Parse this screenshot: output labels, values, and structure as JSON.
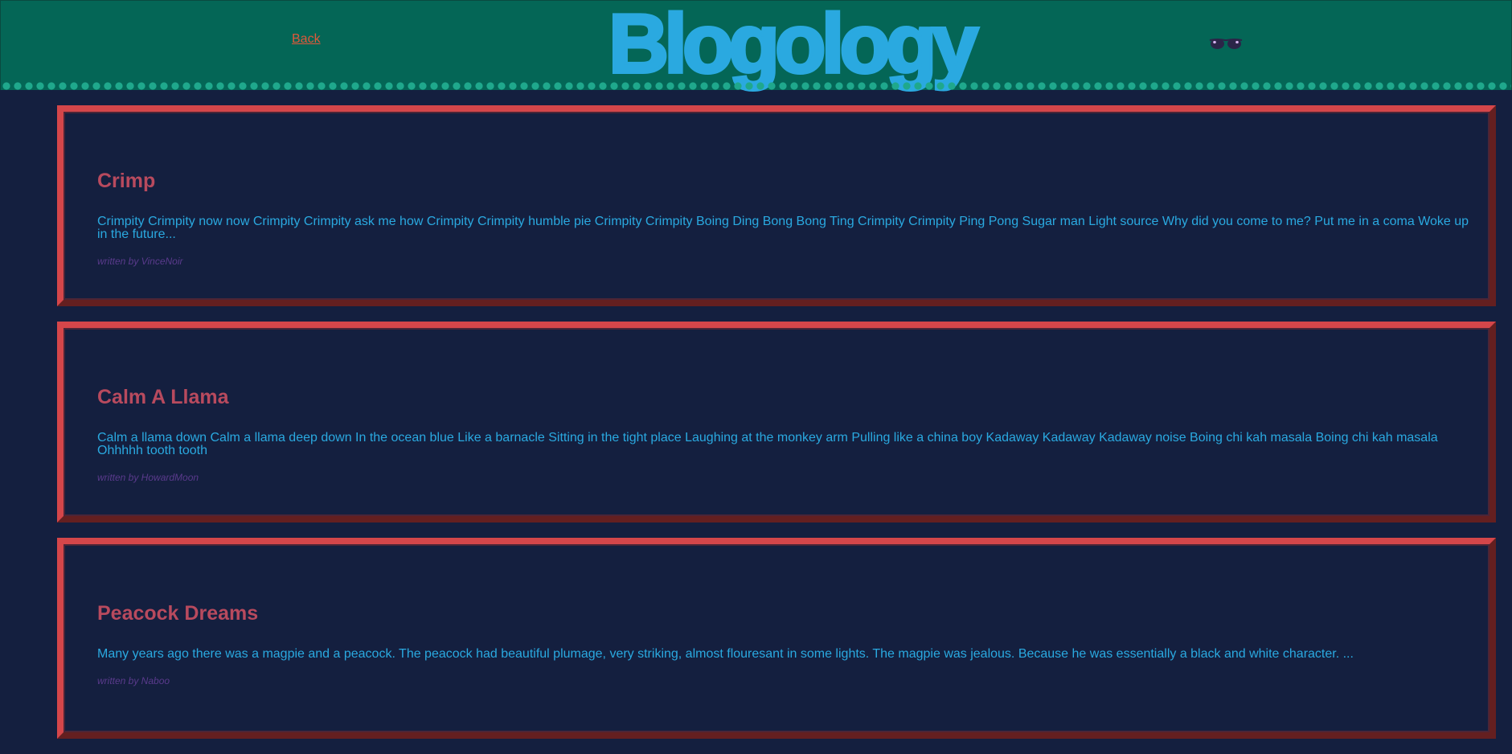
{
  "header": {
    "back_label": "Back",
    "logo_text": "Blogology",
    "glasses_icon": "sunglasses-icon",
    "colors": {
      "background": "#046656",
      "logo": "#2aa9e0",
      "back_link": "#e0583a",
      "dots": "#1fa88c"
    }
  },
  "posts": [
    {
      "title": "Crimp",
      "body": "Crimpity Crimpity now now Crimpity Crimpity ask me how Crimpity Crimpity humble pie Crimpity Crimpity Boing Ding Bong Bong Ting Crimpity Crimpity Ping Pong Sugar man Light source Why did you come to me? Put me in a coma Woke up in the future...",
      "author": "written by VinceNoir"
    },
    {
      "title": "Calm A Llama",
      "body": "Calm a llama down Calm a llama deep down In the ocean blue Like a barnacle Sitting in the tight place Laughing at the monkey arm Pulling like a china boy Kadaway Kadaway Kadaway noise Boing chi kah masala Boing chi kah masala Ohhhhh tooth tooth",
      "author": "written by HowardMoon"
    },
    {
      "title": "Peacock Dreams",
      "body": "Many years ago there was a magpie and a peacock. The peacock had beautiful plumage, very striking, almost flouresant in some lights. The magpie was jealous. Because he was essentially a black and white character. ...",
      "author": "written by Naboo"
    }
  ],
  "colors": {
    "page_background": "#141f3f",
    "card_border": "#cd4042",
    "title": "#b84a5e",
    "body_text": "#2aa9e0",
    "author": "#5a3a8c"
  }
}
